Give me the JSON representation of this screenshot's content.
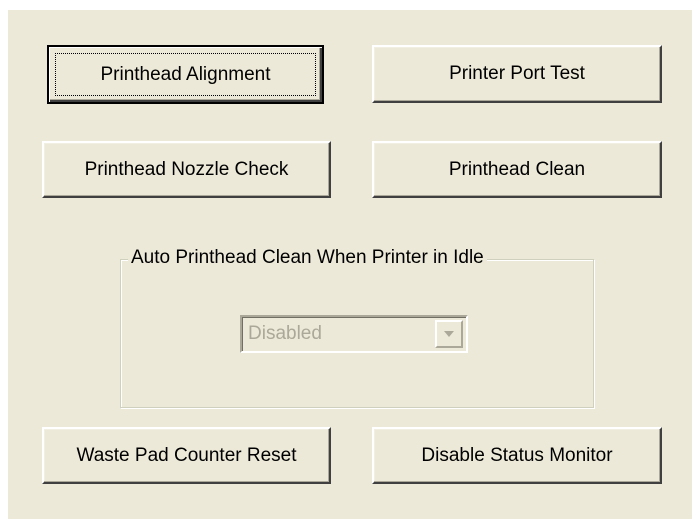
{
  "buttons": {
    "printhead_alignment": "Printhead Alignment",
    "printer_port_test": "Printer Port Test",
    "printhead_nozzle_check": "Printhead Nozzle Check",
    "printhead_clean": "Printhead Clean",
    "waste_pad_counter_reset": "Waste Pad Counter Reset",
    "disable_status_monitor": "Disable Status Monitor"
  },
  "auto_clean_group": {
    "legend": "Auto Printhead Clean When Printer in Idle",
    "combo": {
      "selected": "Disabled",
      "enabled": false,
      "arrow_icon": "chevron-down-icon"
    }
  },
  "colors": {
    "dialog_bg": "#ece9d8",
    "disabled_text": "#aca899"
  }
}
